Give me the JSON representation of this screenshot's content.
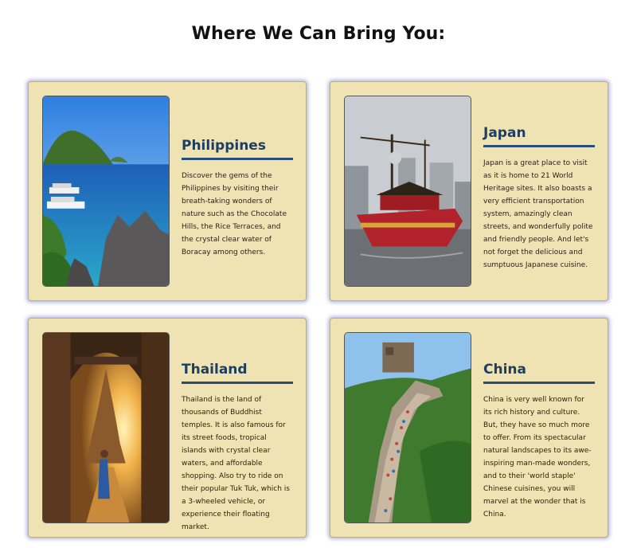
{
  "heading": "Where We Can Bring You:",
  "destinations": [
    {
      "name": "Philippines",
      "photo_icon": "island-lagoon-photo",
      "description": "Discover the gems of the Philippines by visiting their breath-taking wonders of nature such as the Chocolate Hills, the Rice Terraces, and the crystal clear water of Boracay among others."
    },
    {
      "name": "Japan",
      "photo_icon": "red-ship-photo",
      "description": "Japan is a great place to visit as it is home to 21 World Heritage sites. It also boasts a very efficient transportation system, amazingly clean streets, and wonderfully polite and friendly people. And let's not forget the delicious and sumptuous Japanese cuisine."
    },
    {
      "name": "Thailand",
      "photo_icon": "temple-arch-photo",
      "description": "Thailand is the land of thousands of Buddhist temples. It is also famous for its street foods, tropical islands with crystal clear waters, and affordable shopping. Also try to ride on their popular Tuk Tuk, which is a 3-wheeled vehicle, or experience their floating market."
    },
    {
      "name": "China",
      "photo_icon": "great-wall-photo",
      "description": "China is very well known for its rich history and culture. But, they have so much more to offer. From its spectacular natural landscapes to its awe-inspiring man-made wonders, and to their 'world staple' Chinese cuisines, you will marvel at the wonder that is China."
    }
  ],
  "colors": {
    "card_background": "#efe2b3",
    "heading_accent": "#1e3d5f",
    "card_glow": "#7882c8"
  }
}
